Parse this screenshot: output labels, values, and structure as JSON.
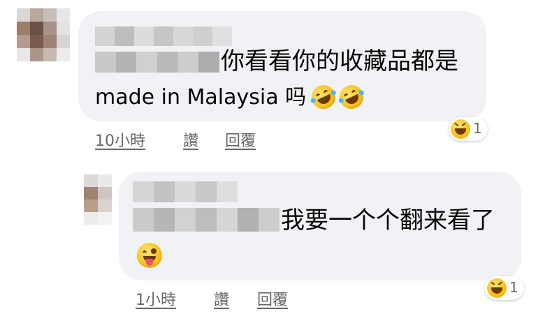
{
  "comments": [
    {
      "text_line1": "你看看你的收藏品都是",
      "text_line2": "made in Malaysia 吗",
      "emojis": [
        "rolling-on-floor-laughing",
        "rolling-on-floor-laughing"
      ],
      "actions": {
        "time": "10小時",
        "like": "讚",
        "reply": "回覆"
      },
      "reaction": {
        "icon": "laughing-face",
        "count": "1"
      }
    },
    {
      "text_line1": "我要一个个翻来看了",
      "emojis": [
        "winking-face-with-tongue"
      ],
      "actions": {
        "time": "1小時",
        "like": "讚",
        "reply": "回覆"
      },
      "reaction": {
        "icon": "laughing-face",
        "count": "1"
      }
    }
  ],
  "colors": {
    "bubble": "#f0f2f5",
    "text": "#050505",
    "meta": "#65676b",
    "blur": "#c8c8c8"
  }
}
